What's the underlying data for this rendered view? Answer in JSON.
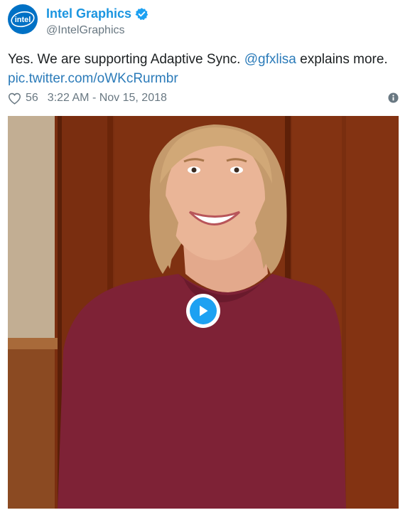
{
  "account": {
    "display_name": "Intel Graphics",
    "handle": "@IntelGraphics",
    "avatar_logo_text": "intel",
    "verified": true
  },
  "tweet": {
    "text_before_mention": "Yes. We are supporting Adaptive Sync. ",
    "mention": "@gfxlisa",
    "text_after_mention": " explains more.",
    "media_link": "pic.twitter.com/oWKcRurmbr"
  },
  "meta": {
    "like_count": "56",
    "timestamp": "3:22 AM - Nov 15, 2018"
  },
  "icons": {
    "verified": "verified-badge-icon",
    "like": "heart-icon",
    "info": "info-icon",
    "play": "play-icon"
  },
  "colors": {
    "accent": "#1b95e0",
    "link": "#2b7bb9",
    "secondary_text": "#697882",
    "intel_blue": "#0071c5",
    "play_blue": "#1da1f2"
  }
}
